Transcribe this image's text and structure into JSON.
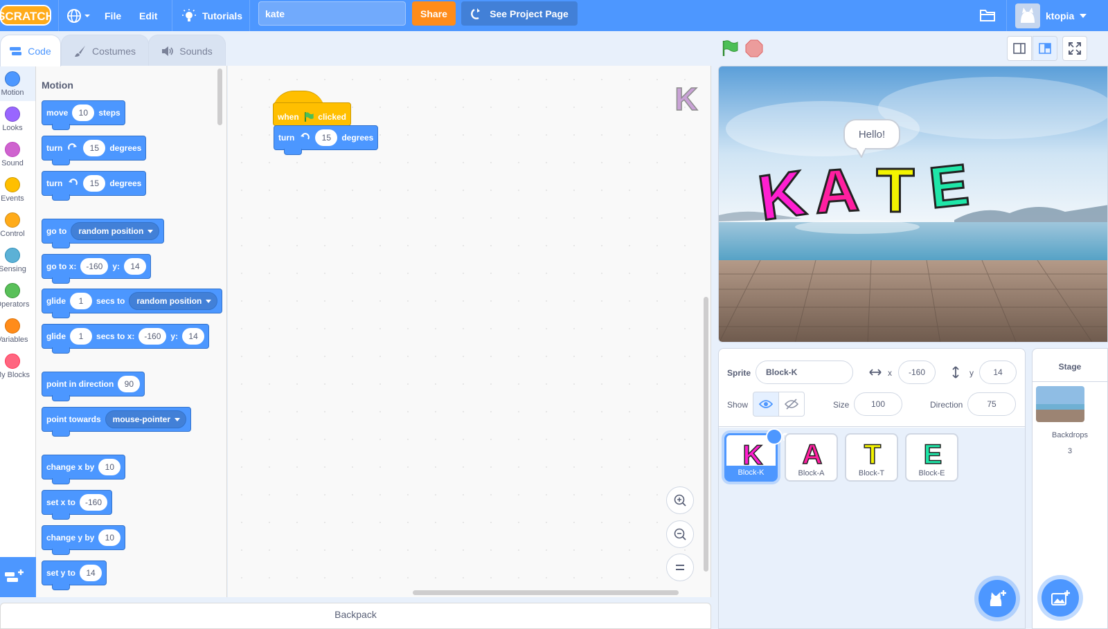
{
  "menubar": {
    "logo_text": "SCRATCH",
    "file": "File",
    "edit": "Edit",
    "tutorials": "Tutorials",
    "project_title": "kate",
    "share": "Share",
    "see_project_page": "See Project Page",
    "username": "ktopia"
  },
  "tabs": {
    "code": "Code",
    "costumes": "Costumes",
    "sounds": "Sounds"
  },
  "categories": [
    {
      "label": "Motion",
      "color": "#4c97ff"
    },
    {
      "label": "Looks",
      "color": "#9966ff"
    },
    {
      "label": "Sound",
      "color": "#cf63cf"
    },
    {
      "label": "Events",
      "color": "#ffbf00"
    },
    {
      "label": "Control",
      "color": "#ffab19"
    },
    {
      "label": "Sensing",
      "color": "#5cb1d6"
    },
    {
      "label": "Operators",
      "color": "#59c059"
    },
    {
      "label": "Variables",
      "color": "#ff8c1a"
    },
    {
      "label": "My Blocks",
      "color": "#ff6680"
    }
  ],
  "flyout": {
    "heading": "Motion",
    "move": {
      "a": "move",
      "n": "10",
      "b": "steps"
    },
    "turn_right": {
      "a": "turn",
      "n": "15",
      "b": "degrees"
    },
    "turn_left": {
      "a": "turn",
      "n": "15",
      "b": "degrees"
    },
    "goto": {
      "a": "go to",
      "opt": "random position"
    },
    "goto_xy": {
      "a": "go to x:",
      "x": "-160",
      "b": "y:",
      "y": "14"
    },
    "glide": {
      "a": "glide",
      "n": "1",
      "b": "secs to",
      "opt": "random position"
    },
    "glide_xy": {
      "a": "glide",
      "n": "1",
      "b": "secs to x:",
      "x": "-160",
      "c": "y:",
      "y": "14"
    },
    "point_dir": {
      "a": "point in direction",
      "n": "90"
    },
    "point_towards": {
      "a": "point towards",
      "opt": "mouse-pointer"
    },
    "change_x": {
      "a": "change x by",
      "n": "10"
    },
    "set_x": {
      "a": "set x to",
      "n": "-160"
    },
    "change_y": {
      "a": "change y by",
      "n": "10"
    },
    "set_y": {
      "a": "set y to",
      "n": "14"
    }
  },
  "script": {
    "hat_a": "when",
    "hat_b": "clicked",
    "turn": {
      "a": "turn",
      "n": "15",
      "b": "degrees"
    }
  },
  "backpack": "Backpack",
  "stage": {
    "speech": "Hello!",
    "letters": [
      "K",
      "A",
      "T",
      "E"
    ]
  },
  "sprite_info": {
    "sprite_label": "Sprite",
    "sprite_name": "Block-K",
    "x_label": "x",
    "x": "-160",
    "y_label": "y",
    "y": "14",
    "show_label": "Show",
    "size_label": "Size",
    "size": "100",
    "direction_label": "Direction",
    "direction": "75"
  },
  "sprites": [
    {
      "name": "Block-K",
      "letter": "K",
      "color": "#ff1fd0"
    },
    {
      "name": "Block-A",
      "letter": "A",
      "color": "#ff1fa0"
    },
    {
      "name": "Block-T",
      "letter": "T",
      "color": "#f4f400"
    },
    {
      "name": "Block-E",
      "letter": "E",
      "color": "#1fe6a8"
    }
  ],
  "stage_pane": {
    "title": "Stage",
    "backdrops_label": "Backdrops",
    "backdrops_count": "3"
  },
  "colors": {
    "menubar": "#4d97ff",
    "motion": "#4c97ff",
    "events": "#ffbf00",
    "share": "#ff8c1a"
  }
}
